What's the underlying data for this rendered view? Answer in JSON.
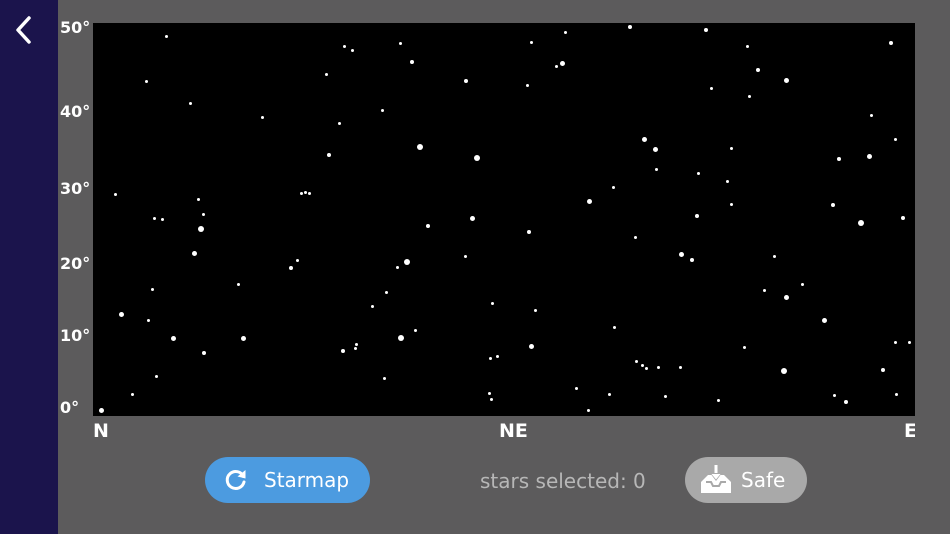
{
  "nav": {
    "back_icon": "chevron-left-icon"
  },
  "starmap": {
    "y_labels": [
      "50°",
      "40°",
      "30°",
      "20°",
      "10°",
      "0°"
    ],
    "x_labels": [
      "N",
      "NE",
      "E"
    ],
    "stars": [
      [
        101,
        410,
        5
      ],
      [
        166,
        36,
        3
      ],
      [
        146,
        81,
        3
      ],
      [
        190,
        103,
        3
      ],
      [
        115,
        194,
        3
      ],
      [
        198,
        199,
        3
      ],
      [
        203,
        214,
        3
      ],
      [
        201,
        229,
        6
      ],
      [
        154,
        218,
        3
      ],
      [
        162,
        219,
        3
      ],
      [
        194,
        253,
        5
      ],
      [
        152,
        289,
        3
      ],
      [
        148,
        320,
        3
      ],
      [
        121,
        314,
        5
      ],
      [
        173,
        338,
        5
      ],
      [
        204,
        353,
        4
      ],
      [
        243,
        338,
        5
      ],
      [
        156,
        376,
        3
      ],
      [
        132,
        394,
        3
      ],
      [
        238,
        284,
        3
      ],
      [
        262,
        117,
        3
      ],
      [
        326,
        74,
        3
      ],
      [
        344,
        46,
        3
      ],
      [
        352,
        50,
        3
      ],
      [
        400,
        43,
        3
      ],
      [
        412,
        62,
        4
      ],
      [
        339,
        123,
        3
      ],
      [
        329,
        155,
        4
      ],
      [
        382,
        110,
        3
      ],
      [
        420,
        147,
        6
      ],
      [
        301,
        193,
        3
      ],
      [
        305,
        192,
        3
      ],
      [
        309,
        193,
        3
      ],
      [
        297,
        260,
        3
      ],
      [
        291,
        268,
        4
      ],
      [
        407,
        262,
        6
      ],
      [
        397,
        267,
        3
      ],
      [
        428,
        226,
        4
      ],
      [
        386,
        292,
        3
      ],
      [
        372,
        306,
        3
      ],
      [
        415,
        330,
        3
      ],
      [
        401,
        338,
        6
      ],
      [
        356,
        344,
        3
      ],
      [
        355,
        348,
        3
      ],
      [
        343,
        351,
        4
      ],
      [
        384,
        378,
        3
      ],
      [
        466,
        81,
        4
      ],
      [
        477,
        158,
        6
      ],
      [
        465,
        256,
        3
      ],
      [
        472,
        218,
        5
      ],
      [
        531,
        42,
        3
      ],
      [
        565,
        32,
        3
      ],
      [
        562,
        63,
        5
      ],
      [
        556,
        66,
        3
      ],
      [
        527,
        85,
        3
      ],
      [
        492,
        303,
        3
      ],
      [
        535,
        310,
        3
      ],
      [
        529,
        232,
        4
      ],
      [
        531,
        346,
        5
      ],
      [
        490,
        358,
        3
      ],
      [
        497,
        356,
        3
      ],
      [
        489,
        393,
        3
      ],
      [
        491,
        399,
        3
      ],
      [
        576,
        388,
        3
      ],
      [
        588,
        410,
        3
      ],
      [
        589,
        201,
        5
      ],
      [
        613,
        187,
        3
      ],
      [
        614,
        327,
        3
      ],
      [
        609,
        394,
        3
      ],
      [
        630,
        27,
        4
      ],
      [
        644,
        139,
        5
      ],
      [
        655,
        149,
        5
      ],
      [
        656,
        169,
        3
      ],
      [
        636,
        361,
        3
      ],
      [
        642,
        365,
        3
      ],
      [
        646,
        368,
        3
      ],
      [
        658,
        367,
        3
      ],
      [
        680,
        367,
        3
      ],
      [
        665,
        396,
        3
      ],
      [
        635,
        237,
        3
      ],
      [
        706,
        30,
        4
      ],
      [
        711,
        88,
        3
      ],
      [
        698,
        173,
        3
      ],
      [
        697,
        216,
        4
      ],
      [
        681,
        254,
        5
      ],
      [
        692,
        260,
        4
      ],
      [
        747,
        46,
        3
      ],
      [
        758,
        70,
        4
      ],
      [
        749,
        96,
        3
      ],
      [
        786,
        80,
        5
      ],
      [
        731,
        148,
        3
      ],
      [
        727,
        181,
        3
      ],
      [
        731,
        204,
        3
      ],
      [
        774,
        256,
        3
      ],
      [
        764,
        290,
        3
      ],
      [
        802,
        284,
        3
      ],
      [
        786,
        297,
        5
      ],
      [
        744,
        347,
        3
      ],
      [
        784,
        371,
        6
      ],
      [
        718,
        400,
        3
      ],
      [
        891,
        43,
        4
      ],
      [
        871,
        115,
        3
      ],
      [
        895,
        139,
        3
      ],
      [
        869,
        156,
        5
      ],
      [
        839,
        159,
        4
      ],
      [
        833,
        205,
        4
      ],
      [
        861,
        223,
        6
      ],
      [
        903,
        218,
        4
      ],
      [
        824,
        320,
        5
      ],
      [
        895,
        342,
        3
      ],
      [
        909,
        342,
        3
      ],
      [
        883,
        370,
        4
      ],
      [
        834,
        395,
        3
      ],
      [
        846,
        402,
        4
      ],
      [
        896,
        394,
        3
      ]
    ]
  },
  "controls": {
    "starmap_label": "Starmap",
    "starmap_icon": "refresh-icon",
    "status_text": "stars selected: 0",
    "safe_label": "Safe",
    "safe_icon": "inbox-download-icon"
  },
  "colors": {
    "sidebar": "#1b144c",
    "background": "#5c5b5c",
    "sky": "#000000",
    "primary_button": "#4c9be0",
    "secondary_button": "#a9a9a9",
    "status_text": "#b7b7b7"
  }
}
